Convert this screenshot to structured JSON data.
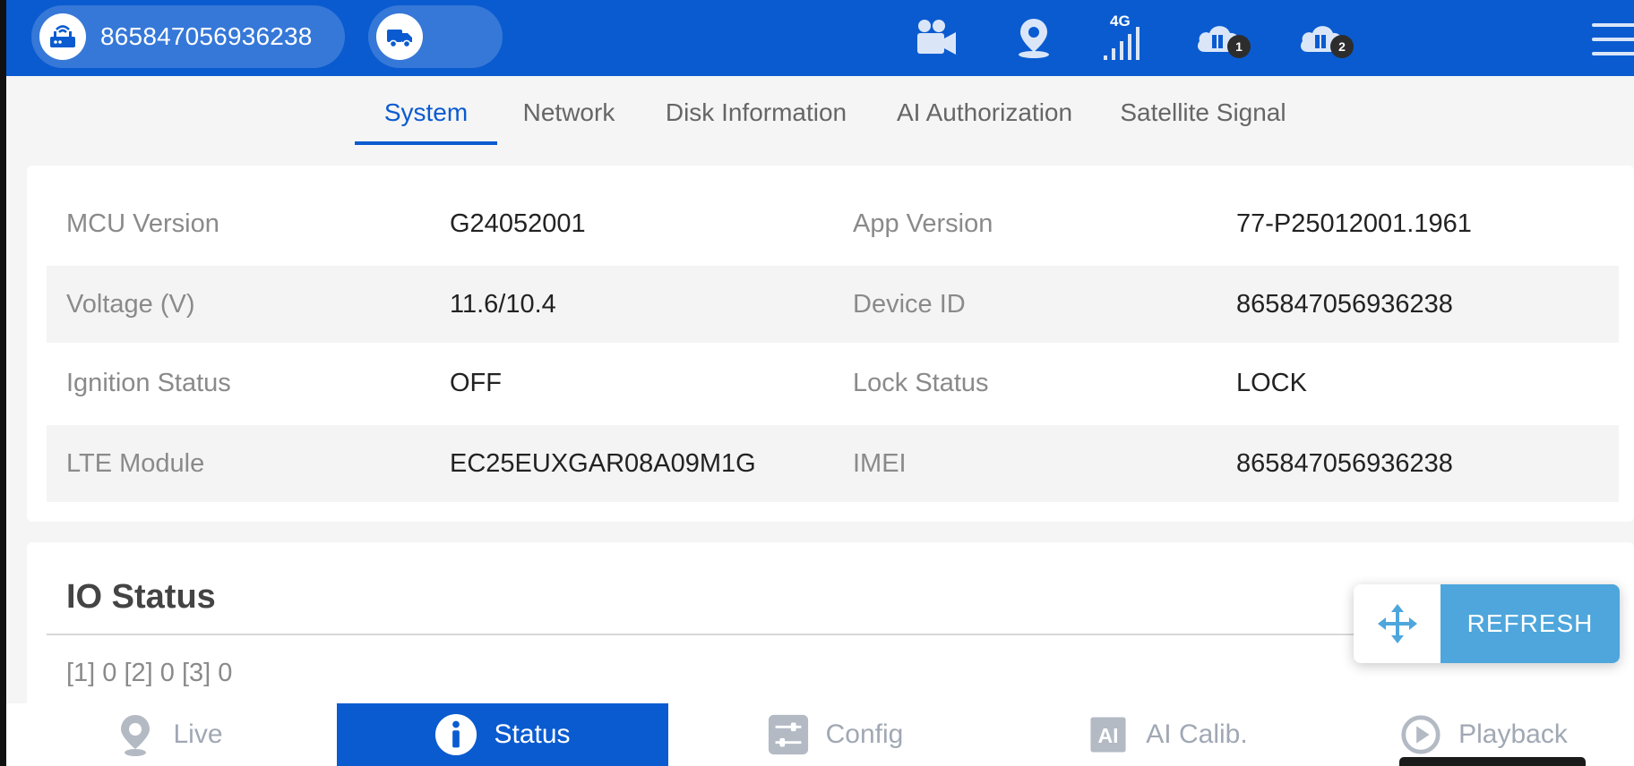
{
  "colors": {
    "header": "#0a5bd0",
    "accent": "#0a5bd0",
    "refresh": "#4ea6dc"
  },
  "header": {
    "device_id": "865847056936238",
    "network_type": "4G",
    "cloud_badges": [
      "1",
      "2"
    ],
    "icons": [
      "router-icon",
      "truck-icon",
      "camera-icon",
      "location-icon",
      "signal-icon",
      "cloud-server-icon",
      "cloud-server-icon",
      "menu-icon"
    ]
  },
  "tabs": [
    {
      "label": "System",
      "active": true
    },
    {
      "label": "Network",
      "active": false
    },
    {
      "label": "Disk Information",
      "active": false
    },
    {
      "label": "AI Authorization",
      "active": false
    },
    {
      "label": "Satellite Signal",
      "active": false
    }
  ],
  "system": {
    "rows": [
      {
        "label1": "MCU Version",
        "value1": "G24052001",
        "label2": "App Version",
        "value2": "77-P25012001.1961"
      },
      {
        "label1": "Voltage (V)",
        "value1": "11.6/10.4",
        "label2": "Device ID",
        "value2": "865847056936238"
      },
      {
        "label1": "Ignition Status",
        "value1": "OFF",
        "label2": "Lock Status",
        "value2": "LOCK"
      },
      {
        "label1": "LTE Module",
        "value1": "EC25EUXGAR08A09M1G",
        "label2": "IMEI",
        "value2": "865847056936238"
      }
    ]
  },
  "io": {
    "title": "IO Status",
    "values": "[1] 0 [2] 0 [3] 0"
  },
  "refresh": {
    "label": "REFRESH"
  },
  "bottom_nav": [
    {
      "label": "Live",
      "icon": "live-location-icon",
      "active": false
    },
    {
      "label": "Status",
      "icon": "info-icon",
      "active": true
    },
    {
      "label": "Config",
      "icon": "config-sliders-icon",
      "active": false
    },
    {
      "label": "AI Calib.",
      "icon": "ai-chip-icon",
      "active": false
    },
    {
      "label": "Playback",
      "icon": "playback-icon",
      "active": false
    }
  ]
}
